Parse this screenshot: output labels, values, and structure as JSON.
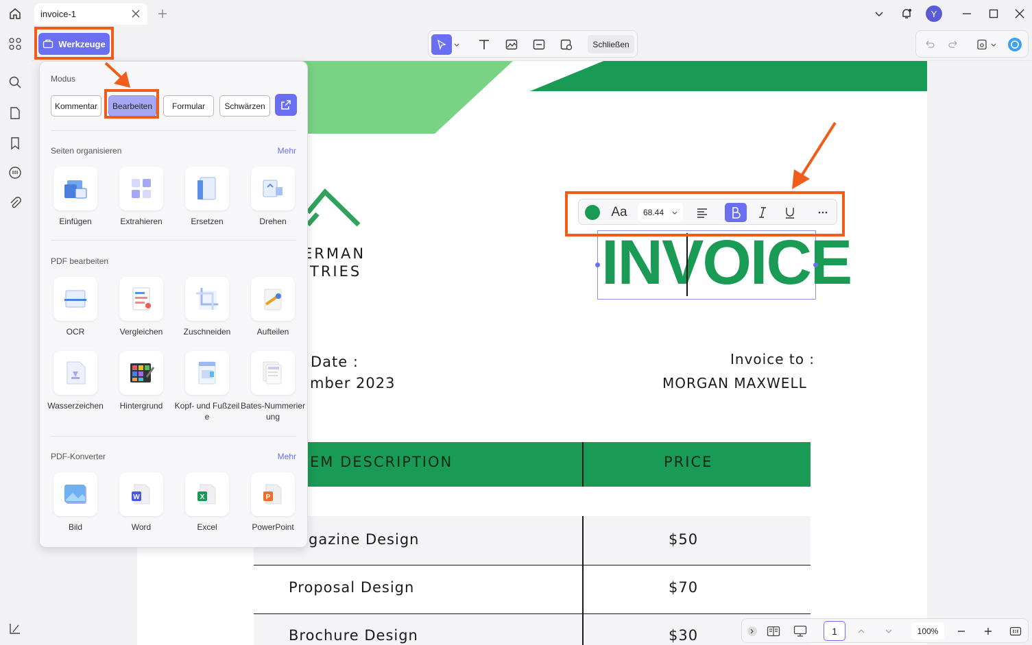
{
  "tab": {
    "title": "invoice-1"
  },
  "user": {
    "initial": "Y"
  },
  "toolbar": {
    "tools_label": "Werkzeuge",
    "close_label": "Schließen"
  },
  "panel": {
    "mode_title": "Modus",
    "modes": [
      "Kommentar",
      "Bearbeiten",
      "Formular",
      "Schwärzen"
    ],
    "active_mode": "Bearbeiten",
    "organize_title": "Seiten organisieren",
    "organize_more": "Mehr",
    "organize_tools": [
      "Einfügen",
      "Extrahieren",
      "Ersetzen",
      "Drehen"
    ],
    "edit_title": "PDF bearbeiten",
    "edit_tools": [
      "OCR",
      "Vergleichen",
      "Zuschneiden",
      "Aufteilen",
      "Wasserzeichen",
      "Hintergrund",
      "Kopf- und Fußzeile",
      "Bates-Nummerierung"
    ],
    "convert_title": "PDF-Konverter",
    "convert_more": "Mehr",
    "convert_tools": [
      "Bild",
      "Word",
      "Excel",
      "PowerPoint"
    ]
  },
  "format_bar": {
    "font_icon": "Aa",
    "font_size": "68.44"
  },
  "document": {
    "company_line1": "ERMAN",
    "company_line2": "TRIES",
    "invoice_title": "INVOICE",
    "date_label": "Date :",
    "date_value": "mber 2023",
    "invoice_to_label": "Invoice to :",
    "invoice_to_value": "MORGAN MAXWELL",
    "col_desc": "EM DESCRIPTION",
    "col_price": "PRICE",
    "rows": [
      {
        "desc": "gazine Design",
        "price": "$50"
      },
      {
        "desc": "Proposal Design",
        "price": "$70"
      },
      {
        "desc": "Brochure Design",
        "price": "$30"
      }
    ]
  },
  "status": {
    "page": "1",
    "zoom": "100%"
  },
  "colors": {
    "accent": "#6a6ef0",
    "brand_green": "#1a9b55",
    "light_green": "#78d384",
    "highlight": "#f25c19"
  }
}
